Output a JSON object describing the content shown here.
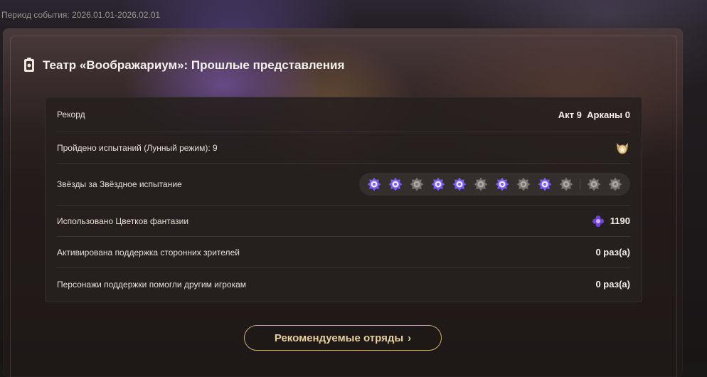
{
  "header": {
    "period": "Период события: 2026.01.01-2026.02.01"
  },
  "panel": {
    "title": "Театр «Воображариум»: Прошлые представления",
    "title_icon": "theater-ticket-icon"
  },
  "stats": {
    "record_label": "Рекорд",
    "record_value": "Акт 9  Арканы 0",
    "trials_label": "Пройдено испытаний (Лунный режим): 9",
    "trials_badge_icon": "medal-icon",
    "stars_label": "Звёзды за Звёздное испытание",
    "stars": [
      true,
      true,
      false,
      true,
      true,
      false,
      true,
      false,
      true,
      false,
      false,
      false
    ],
    "stars_active_color": "#7b5cf0",
    "stars_inactive_color": "#7a7470",
    "flowers_label": "Использовано Цветков фантазии",
    "flowers_value": "1190",
    "flowers_icon": "fantasy-flower-icon",
    "support_label": "Активирована поддержка сторонних зрителей",
    "support_value": "0 раз(а)",
    "helped_label": "Персонажи поддержки помогли другим игрокам",
    "helped_value": "0 раз(а)"
  },
  "actions": {
    "recommended_label": "Рекомендуемые отряды",
    "recommended_arrow": "›"
  },
  "colors": {
    "accent_gold": "#c9ad7c",
    "text_primary": "#f3efe9"
  }
}
